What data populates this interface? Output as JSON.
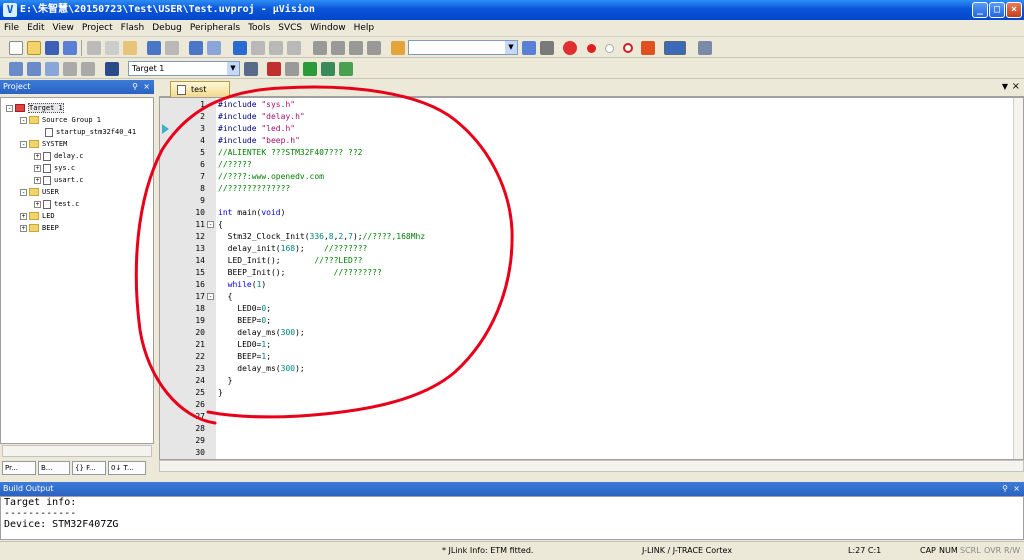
{
  "window": {
    "title": "E:\\朱智慧\\20150723\\Test\\USER\\Test.uvproj - µVision",
    "app_icon": "V",
    "min": "_",
    "max": "□",
    "close": "×"
  },
  "menu": [
    "File",
    "Edit",
    "View",
    "Project",
    "Flash",
    "Debug",
    "Peripherals",
    "Tools",
    "SVCS",
    "Window",
    "Help"
  ],
  "toolbar2": {
    "target_label": "Target 1"
  },
  "project_panel": {
    "title": "Project",
    "tree": [
      {
        "label": "Target 1",
        "type": "target",
        "indent": 0,
        "pm": "-"
      },
      {
        "label": "Source Group 1",
        "type": "folder",
        "indent": 1,
        "pm": "-"
      },
      {
        "label": "startup_stm32f40_41",
        "type": "file",
        "indent": 2,
        "pm": ""
      },
      {
        "label": "SYSTEM",
        "type": "folder",
        "indent": 1,
        "pm": "-"
      },
      {
        "label": "delay.c",
        "type": "file",
        "indent": 2,
        "pm": "+"
      },
      {
        "label": "sys.c",
        "type": "file",
        "indent": 2,
        "pm": "+"
      },
      {
        "label": "usart.c",
        "type": "file",
        "indent": 2,
        "pm": "+"
      },
      {
        "label": "USER",
        "type": "folder",
        "indent": 1,
        "pm": "-"
      },
      {
        "label": "test.c",
        "type": "file",
        "indent": 2,
        "pm": "+"
      },
      {
        "label": "LED",
        "type": "folder",
        "indent": 1,
        "pm": "+"
      },
      {
        "label": "BEEP",
        "type": "folder",
        "indent": 1,
        "pm": "+"
      }
    ],
    "bottom_tabs": [
      "Pr...",
      "B...",
      "{} F...",
      "0↓ T..."
    ]
  },
  "editor": {
    "tab": "test",
    "lines": [
      [
        {
          "t": "#include ",
          "c": "pp"
        },
        {
          "t": "\"sys.h\"",
          "c": "str"
        }
      ],
      [
        {
          "t": "#include ",
          "c": "pp"
        },
        {
          "t": "\"delay.h\"",
          "c": "str"
        }
      ],
      [
        {
          "t": "#include ",
          "c": "pp"
        },
        {
          "t": "\"led.h\"",
          "c": "str"
        }
      ],
      [
        {
          "t": "#include ",
          "c": "pp"
        },
        {
          "t": "\"beep.h\"",
          "c": "str"
        }
      ],
      [
        {
          "t": "//ALIENTEK ???STM32F407??? ??2",
          "c": "cmt"
        }
      ],
      [
        {
          "t": "//?????",
          "c": "cmt"
        }
      ],
      [
        {
          "t": "//????:www.openedv.com",
          "c": "cmt"
        }
      ],
      [
        {
          "t": "//?????????????",
          "c": "cmt"
        }
      ],
      [],
      [
        {
          "t": "int ",
          "c": "kw"
        },
        {
          "t": "main(",
          "c": ""
        },
        {
          "t": "void",
          "c": "kw"
        },
        {
          "t": ")",
          "c": ""
        }
      ],
      [
        {
          "t": "{",
          "c": ""
        }
      ],
      [
        {
          "t": "  Stm32_Clock_Init(",
          "c": ""
        },
        {
          "t": "336",
          "c": "num"
        },
        {
          "t": ",",
          "c": ""
        },
        {
          "t": "8",
          "c": "num"
        },
        {
          "t": ",",
          "c": ""
        },
        {
          "t": "2",
          "c": "num"
        },
        {
          "t": ",",
          "c": ""
        },
        {
          "t": "7",
          "c": "num"
        },
        {
          "t": ");",
          "c": ""
        },
        {
          "t": "//????,168Mhz",
          "c": "cmt"
        }
      ],
      [
        {
          "t": "  delay_init(",
          "c": ""
        },
        {
          "t": "168",
          "c": "num"
        },
        {
          "t": ");    ",
          "c": ""
        },
        {
          "t": "//???????",
          "c": "cmt"
        }
      ],
      [
        {
          "t": "  LED_Init();       ",
          "c": ""
        },
        {
          "t": "//???LED??",
          "c": "cmt"
        }
      ],
      [
        {
          "t": "  BEEP_Init();          ",
          "c": ""
        },
        {
          "t": "//????????",
          "c": "cmt"
        }
      ],
      [
        {
          "t": "  ",
          "c": ""
        },
        {
          "t": "while",
          "c": "kw"
        },
        {
          "t": "(",
          "c": ""
        },
        {
          "t": "1",
          "c": "num"
        },
        {
          "t": ")",
          "c": ""
        }
      ],
      [
        {
          "t": "  {",
          "c": ""
        }
      ],
      [
        {
          "t": "    LED0=",
          "c": ""
        },
        {
          "t": "0",
          "c": "num"
        },
        {
          "t": ";",
          "c": ""
        }
      ],
      [
        {
          "t": "    BEEP=",
          "c": ""
        },
        {
          "t": "0",
          "c": "num"
        },
        {
          "t": ";",
          "c": ""
        }
      ],
      [
        {
          "t": "    delay_ms(",
          "c": ""
        },
        {
          "t": "300",
          "c": "num"
        },
        {
          "t": ");",
          "c": ""
        }
      ],
      [
        {
          "t": "    LED0=",
          "c": ""
        },
        {
          "t": "1",
          "c": "num"
        },
        {
          "t": ";",
          "c": ""
        }
      ],
      [
        {
          "t": "    BEEP=",
          "c": ""
        },
        {
          "t": "1",
          "c": "num"
        },
        {
          "t": ";",
          "c": ""
        }
      ],
      [
        {
          "t": "    delay_ms(",
          "c": ""
        },
        {
          "t": "300",
          "c": "num"
        },
        {
          "t": ");",
          "c": ""
        }
      ],
      [
        {
          "t": "  }",
          "c": ""
        }
      ],
      [
        {
          "t": "}",
          "c": ""
        }
      ],
      [],
      [],
      [],
      [],
      []
    ]
  },
  "build_output": {
    "title": "Build Output",
    "lines": [
      "Target info:",
      "------------",
      "Device: STM32F407ZG"
    ]
  },
  "status": {
    "jlink": "* JLink Info: ETM fitted.",
    "debugger": "J-LINK / J-TRACE Cortex",
    "position": "L:27 C:1",
    "cap": "CAP",
    "num": "NUM",
    "scrl": "SCRL",
    "ovr": "OVR",
    "rw": "R/W"
  },
  "colors": {
    "annotation": "#e8001a",
    "title_bar": "#0a55d8"
  }
}
